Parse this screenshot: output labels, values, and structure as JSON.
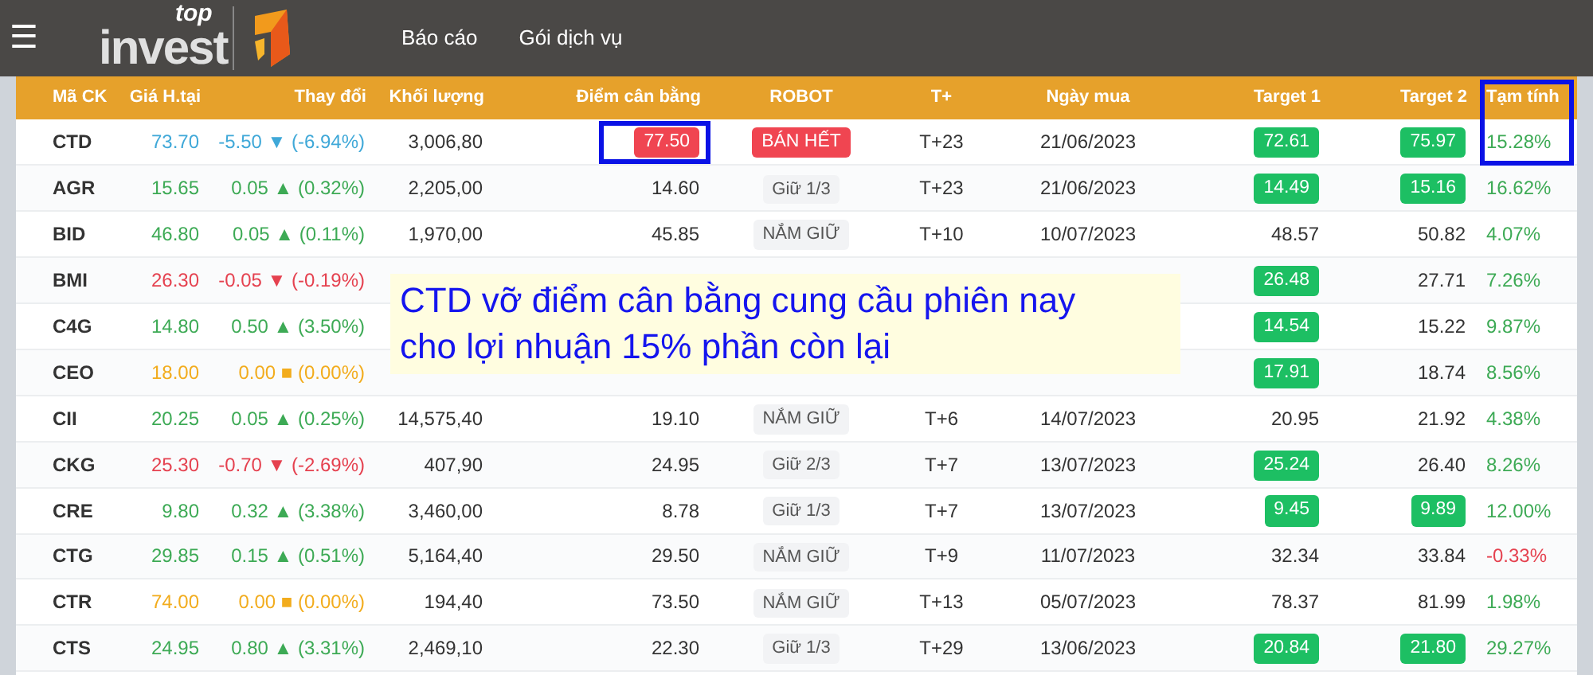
{
  "navbar": {
    "menu_icon": "☰",
    "logo_top": "top",
    "logo_main": "invest",
    "links": [
      {
        "label": "Báo cáo"
      },
      {
        "label": "Gói dịch vụ"
      }
    ]
  },
  "table": {
    "columns": [
      {
        "label": "Mã CK",
        "circled": false
      },
      {
        "label": "Giá H.tại",
        "circled": false
      },
      {
        "label": "Thay đổi",
        "circled": false
      },
      {
        "label": "Khối lượng",
        "circled": false
      },
      {
        "label": "Điểm cân bằng",
        "circled": false
      },
      {
        "label": "ROBOT",
        "circled": false
      },
      {
        "label": "T+",
        "circled": false
      },
      {
        "label": "Ngày mua",
        "circled": false
      },
      {
        "label": "Target 1",
        "circled": false
      },
      {
        "label": "Target 2",
        "circled": false
      },
      {
        "label": "Tạm tính",
        "circled": true
      }
    ],
    "rows": [
      {
        "code": "CTD",
        "price": "73.70",
        "color": "#3fa8d8",
        "change": "-5.50 ▼ (-6.94%)",
        "volume": "3,006,80",
        "balance": "77.50",
        "balance_alert": true,
        "balance_circled": true,
        "robot": {
          "label": "BÁN HẾT",
          "kind": "sell"
        },
        "t": "T+23",
        "date": "21/06/2023",
        "target1": {
          "value": "72.61",
          "hit": true
        },
        "target2": {
          "value": "75.97",
          "hit": true
        },
        "result": {
          "value": "15.28%",
          "color": "#3daa55"
        }
      },
      {
        "code": "AGR",
        "price": "15.65",
        "color": "#3daa55",
        "change": "0.05 ▲ (0.32%)",
        "volume": "2,205,00",
        "balance": "14.60",
        "balance_alert": false,
        "balance_circled": false,
        "robot": {
          "label": "Giữ 1/3",
          "kind": "hold"
        },
        "t": "T+23",
        "date": "21/06/2023",
        "target1": {
          "value": "14.49",
          "hit": true
        },
        "target2": {
          "value": "15.16",
          "hit": true
        },
        "result": {
          "value": "16.62%",
          "color": "#3daa55"
        }
      },
      {
        "code": "BID",
        "price": "46.80",
        "color": "#3daa55",
        "change": "0.05 ▲ (0.11%)",
        "volume": "1,970,00",
        "balance": "45.85",
        "balance_alert": false,
        "balance_circled": false,
        "robot": {
          "label": "NẮM GIỮ",
          "kind": "hold"
        },
        "t": "T+10",
        "date": "10/07/2023",
        "target1": {
          "value": "48.57",
          "hit": false
        },
        "target2": {
          "value": "50.82",
          "hit": false
        },
        "result": {
          "value": "4.07%",
          "color": "#3daa55"
        }
      },
      {
        "code": "BMI",
        "price": "26.30",
        "color": "#e5414f",
        "change": "-0.05 ▼ (-0.19%)",
        "target1": {
          "value": "26.48",
          "hit": true
        },
        "target2": {
          "value": "27.71",
          "hit": false
        },
        "result": {
          "value": "7.26%",
          "color": "#3daa55"
        }
      },
      {
        "code": "C4G",
        "price": "14.80",
        "color": "#3daa55",
        "change": "0.50 ▲ (3.50%)",
        "target1": {
          "value": "14.54",
          "hit": true
        },
        "target2": {
          "value": "15.22",
          "hit": false
        },
        "result": {
          "value": "9.87%",
          "color": "#3daa55"
        }
      },
      {
        "code": "CEO",
        "price": "18.00",
        "color": "#f2ac1d",
        "change": "0.00 ■ (0.00%)",
        "target1": {
          "value": "17.91",
          "hit": true
        },
        "target2": {
          "value": "18.74",
          "hit": false
        },
        "result": {
          "value": "8.56%",
          "color": "#3daa55"
        }
      },
      {
        "code": "CII",
        "price": "20.25",
        "color": "#3daa55",
        "change": "0.05 ▲ (0.25%)",
        "volume": "14,575,40",
        "balance": "19.10",
        "balance_alert": false,
        "balance_circled": false,
        "robot": {
          "label": "NẮM GIỮ",
          "kind": "hold"
        },
        "t": "T+6",
        "date": "14/07/2023",
        "target1": {
          "value": "20.95",
          "hit": false
        },
        "target2": {
          "value": "21.92",
          "hit": false
        },
        "result": {
          "value": "4.38%",
          "color": "#3daa55"
        }
      },
      {
        "code": "CKG",
        "price": "25.30",
        "color": "#e5414f",
        "change": "-0.70 ▼ (-2.69%)",
        "volume": "407,90",
        "balance": "24.95",
        "balance_alert": false,
        "balance_circled": false,
        "robot": {
          "label": "Giữ 2/3",
          "kind": "hold"
        },
        "t": "T+7",
        "date": "13/07/2023",
        "target1": {
          "value": "25.24",
          "hit": true
        },
        "target2": {
          "value": "26.40",
          "hit": false
        },
        "result": {
          "value": "8.26%",
          "color": "#3daa55"
        }
      },
      {
        "code": "CRE",
        "price": "9.80",
        "color": "#3daa55",
        "change": "0.32 ▲ (3.38%)",
        "volume": "3,460,00",
        "balance": "8.78",
        "balance_alert": false,
        "balance_circled": false,
        "robot": {
          "label": "Giữ 1/3",
          "kind": "hold"
        },
        "t": "T+7",
        "date": "13/07/2023",
        "target1": {
          "value": "9.45",
          "hit": true
        },
        "target2": {
          "value": "9.89",
          "hit": true
        },
        "result": {
          "value": "12.00%",
          "color": "#3daa55"
        }
      },
      {
        "code": "CTG",
        "price": "29.85",
        "color": "#3daa55",
        "change": "0.15 ▲ (0.51%)",
        "volume": "5,164,40",
        "balance": "29.50",
        "balance_alert": false,
        "balance_circled": false,
        "robot": {
          "label": "NẮM GIỮ",
          "kind": "hold"
        },
        "t": "T+9",
        "date": "11/07/2023",
        "target1": {
          "value": "32.34",
          "hit": false
        },
        "target2": {
          "value": "33.84",
          "hit": false
        },
        "result": {
          "value": "-0.33%",
          "color": "#e5414f"
        }
      },
      {
        "code": "CTR",
        "price": "74.00",
        "color": "#f2ac1d",
        "change": "0.00 ■ (0.00%)",
        "volume": "194,40",
        "balance": "73.50",
        "balance_alert": false,
        "balance_circled": false,
        "robot": {
          "label": "NẮM GIỮ",
          "kind": "hold"
        },
        "t": "T+13",
        "date": "05/07/2023",
        "target1": {
          "value": "78.37",
          "hit": false
        },
        "target2": {
          "value": "81.99",
          "hit": false
        },
        "result": {
          "value": "1.98%",
          "color": "#3daa55"
        }
      },
      {
        "code": "CTS",
        "price": "24.95",
        "color": "#3daa55",
        "change": "0.80 ▲ (3.31%)",
        "volume": "2,469,10",
        "balance": "22.30",
        "balance_alert": false,
        "balance_circled": false,
        "robot": {
          "label": "Giữ 1/3",
          "kind": "hold"
        },
        "t": "T+29",
        "date": "13/06/2023",
        "target1": {
          "value": "20.84",
          "hit": true
        },
        "target2": {
          "value": "21.80",
          "hit": true
        },
        "result": {
          "value": "29.27%",
          "color": "#3daa55"
        }
      }
    ]
  },
  "annotation": {
    "lines": [
      "CTD vỡ điểm cân bằng cung cầu phiên nay",
      "cho lợi nhuận 15% phần còn lại"
    ]
  }
}
